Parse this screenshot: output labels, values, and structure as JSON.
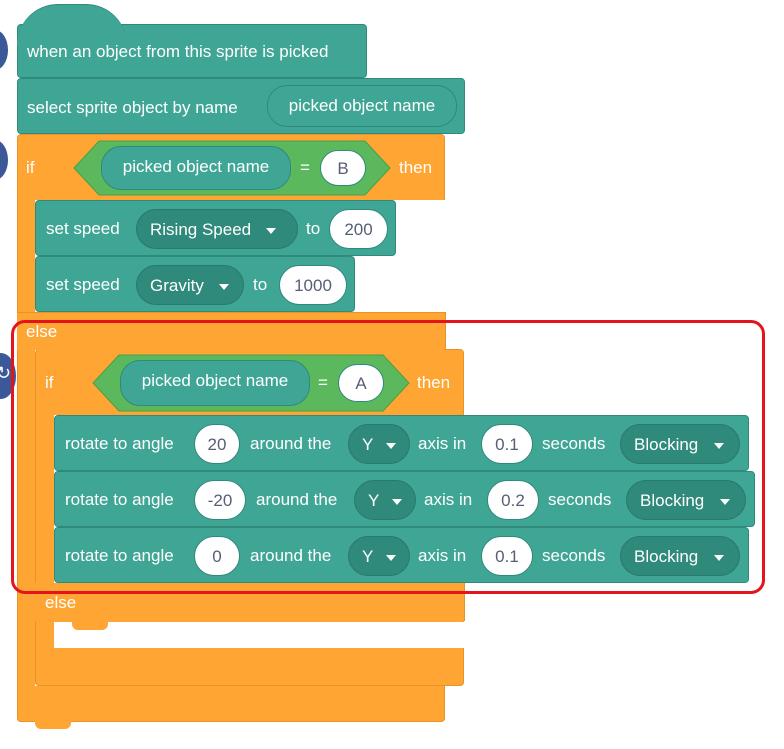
{
  "hat_block": {
    "label": "when an object from this sprite is picked"
  },
  "select_block": {
    "label": "select sprite object by name",
    "reporter": "picked object name"
  },
  "outer_if": {
    "if_label": "if",
    "reporter": "picked object name",
    "operator": "=",
    "value": "B",
    "then_label": "then",
    "else_label": "else"
  },
  "set_speed_1": {
    "label": "set speed",
    "dropdown": "Rising Speed",
    "to_label": "to",
    "value": "200"
  },
  "set_speed_2": {
    "label": "set speed",
    "dropdown": "Gravity",
    "to_label": "to",
    "value": "1000"
  },
  "inner_if": {
    "if_label": "if",
    "reporter": "picked object name",
    "operator": "=",
    "value": "A",
    "then_label": "then",
    "else_label": "else"
  },
  "rotate_blocks": [
    {
      "label": "rotate to angle",
      "angle": "20",
      "around": "around the",
      "axis": "Y",
      "axis_in": "axis in",
      "time": "0.1",
      "seconds": "seconds",
      "mode": "Blocking"
    },
    {
      "label": "rotate to angle",
      "angle": "-20",
      "around": "around the",
      "axis": "Y",
      "axis_in": "axis in",
      "time": "0.2",
      "seconds": "seconds",
      "mode": "Blocking"
    },
    {
      "label": "rotate to angle",
      "angle": "0",
      "around": "around the",
      "axis": "Y",
      "axis_in": "axis in",
      "time": "0.1",
      "seconds": "seconds",
      "mode": "Blocking"
    }
  ],
  "colors": {
    "motion_block": "#3fa695",
    "control_block": "#ffa533",
    "operator_block": "#5cb85c",
    "highlight": "#e3141b"
  }
}
